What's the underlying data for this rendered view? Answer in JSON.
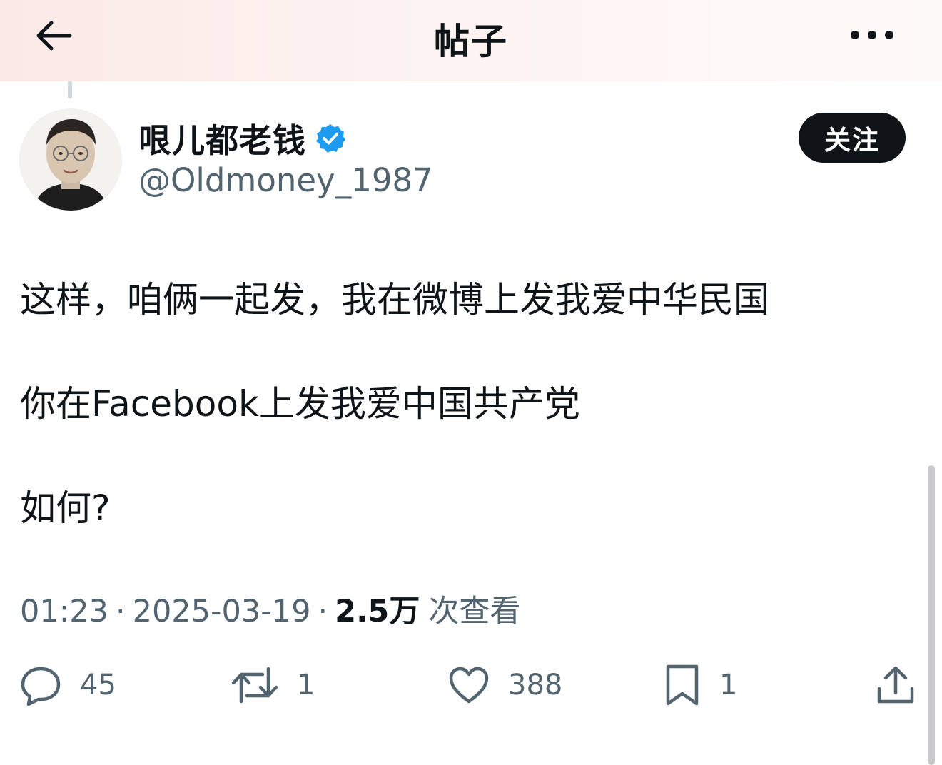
{
  "header": {
    "title": "帖子",
    "back_icon": "arrow-left-icon",
    "more_icon": "more-horizontal-icon"
  },
  "author": {
    "display_name": "哏儿都老钱",
    "verified_icon": "verified-badge-icon",
    "verified_color": "#1d9bf0",
    "handle": "@Oldmoney_1987",
    "follow_label": "关注"
  },
  "post": {
    "lines": [
      "这样，咱俩一起发，我在微博上发我爱中华民国",
      "你在Facebook上发我爱中国共产党",
      "如何?"
    ]
  },
  "meta": {
    "time": "01:23",
    "date": "2025-03-19",
    "views_count": "2.5万",
    "views_label": "次查看"
  },
  "actions": {
    "reply": {
      "icon": "reply-icon",
      "count": "45"
    },
    "repost": {
      "icon": "repost-icon",
      "count": "1"
    },
    "like": {
      "icon": "heart-icon",
      "count": "388"
    },
    "bookmark": {
      "icon": "bookmark-icon",
      "count": "1"
    },
    "share": {
      "icon": "share-icon"
    }
  },
  "colors": {
    "text": "#0f1419",
    "secondary": "#536471",
    "accent": "#1d9bf0"
  }
}
